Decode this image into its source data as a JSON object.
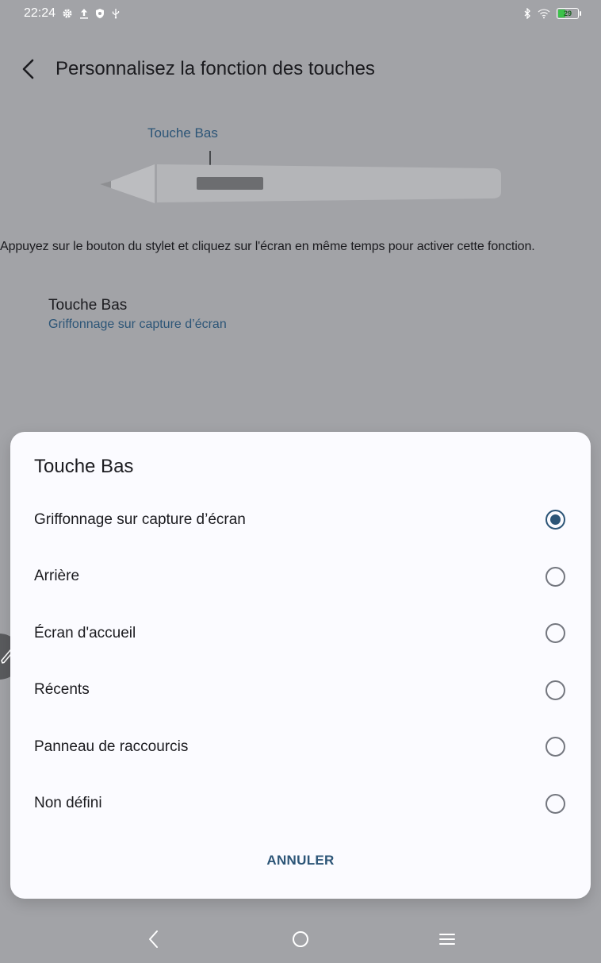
{
  "status_bar": {
    "time": "22:24",
    "left_icons": [
      "gear-icon",
      "upload-icon",
      "shield-icon",
      "usb-icon"
    ],
    "right_icons": [
      "bluetooth-icon",
      "wifi-icon"
    ],
    "battery_level": "29",
    "battery_charging": true
  },
  "header": {
    "title": "Personnalisez la fonction des touches"
  },
  "pen_illustration": {
    "button_label": "Touche Bas"
  },
  "instruction": "Appuyez sur le bouton du stylet et cliquez sur l'écran en même temps pour activer cette fonction.",
  "setting": {
    "title": "Touche Bas",
    "value": "Griffonnage sur capture d’écran"
  },
  "dialog": {
    "title": "Touche Bas",
    "options": [
      {
        "label": "Griffonnage sur capture d’écran",
        "selected": true
      },
      {
        "label": "Arrière",
        "selected": false
      },
      {
        "label": "Écran d'accueil",
        "selected": false
      },
      {
        "label": "Récents",
        "selected": false
      },
      {
        "label": "Panneau de raccourcis",
        "selected": false
      },
      {
        "label": "Non défini",
        "selected": false
      }
    ],
    "cancel_label": "ANNULER"
  },
  "colors": {
    "accent": "#2c5577",
    "scrim_background": "#a2a3a7",
    "dialog_background": "#fbfbff"
  }
}
